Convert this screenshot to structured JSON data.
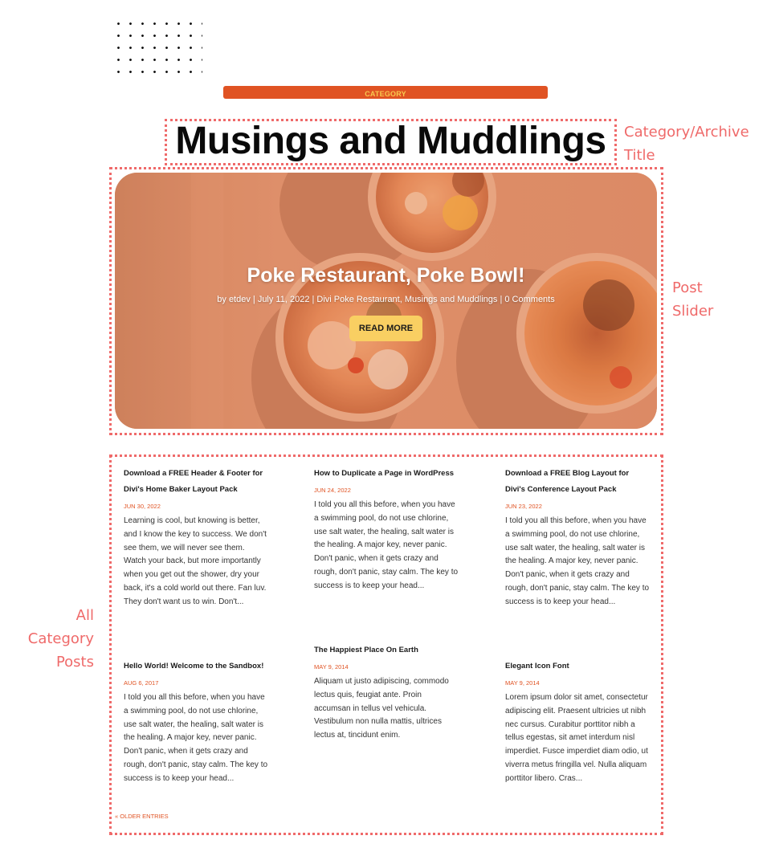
{
  "category_label": "CATEGORY",
  "archive_title": "Musings and Muddlings",
  "annotations": {
    "title_label_line1": "Category/Archive",
    "title_label_line2": "Title",
    "slider_label_line1": "Post",
    "slider_label_line2": "Slider",
    "posts_label_line1": "All",
    "posts_label_line2": "Category",
    "posts_label_line3": "Posts"
  },
  "slider": {
    "title": "Poke Restaurant, Poke Bowl!",
    "meta": "by etdev | July 11, 2022 | Divi Poke Restaurant, Musings and Muddlings | 0 Comments",
    "button_label": "READ MORE"
  },
  "posts": [
    {
      "title": "Download a FREE Header & Footer for Divi's Home Baker Layout Pack",
      "date": "JUN 30, 2022",
      "excerpt": "Learning is cool, but knowing is better, and I know the key to success. We don't see them, we will never see them. Watch your back, but more importantly when you get out the shower, dry your back, it's a cold world out there. Fan luv. They don't want us to win. Don't..."
    },
    {
      "title": "How to Duplicate a Page in WordPress",
      "date": "JUN 24, 2022",
      "excerpt": "I told you all this before, when you have a swimming pool, do not use chlorine, use salt water, the healing, salt water is the healing. A major key, never panic. Don't panic, when it gets crazy and rough, don't panic, stay calm. The key to success is to keep your head..."
    },
    {
      "title": "Download a FREE Blog Layout for Divi's Conference Layout Pack",
      "date": "JUN 23, 2022",
      "excerpt": "I told you all this before, when you have a swimming pool, do not use chlorine, use salt water, the healing, salt water is the healing. A major key, never panic. Don't panic, when it gets crazy and rough, don't panic, stay calm. The key to success is to keep your head..."
    },
    {
      "title": "Hello World! Welcome to the Sandbox!",
      "date": "AUG 6, 2017",
      "excerpt": "I told you all this before, when you have a swimming pool, do not use chlorine, use salt water, the healing, salt water is the healing. A major key, never panic. Don't panic, when it gets crazy and rough, don't panic, stay calm. The key to success is to keep your head..."
    },
    {
      "title": "The Happiest Place On Earth",
      "date": "MAY 9, 2014",
      "excerpt": "Aliquam ut justo adipiscing, commodo lectus quis, feugiat ante. Proin accumsan in tellus vel vehicula. Vestibulum non nulla mattis, ultrices lectus at, tincidunt enim."
    },
    {
      "title": "Elegant Icon Font",
      "date": "MAY 9, 2014",
      "excerpt": "Lorem ipsum dolor sit amet, consectetur adipiscing elit. Praesent ultricies ut nibh nec cursus. Curabitur porttitor nibh a tellus egestas, sit amet interdum nisl imperdiet. Fusce imperdiet diam odio, ut viverra metus fringilla vel. Nulla aliquam porttitor libero. Cras..."
    }
  ],
  "pagination": {
    "older_entries_label": "« OLDER ENTRIES"
  },
  "colors": {
    "accent_orange": "#e05323",
    "accent_yellow": "#f9cf62",
    "annotation_red": "#ef6a6a"
  }
}
